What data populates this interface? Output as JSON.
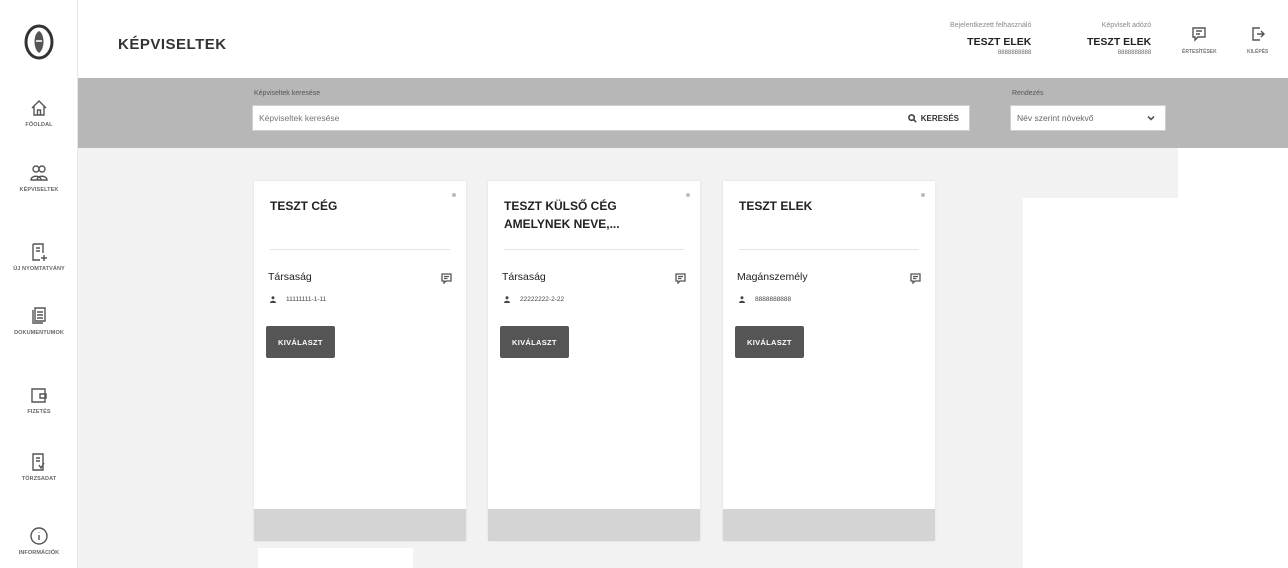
{
  "sidebar": {
    "items": [
      {
        "id": "fooldal",
        "label": "FŐOLDAL",
        "icon": "home-icon"
      },
      {
        "id": "kepviseltek",
        "label": "KÉPVISELTEK",
        "icon": "users-icon"
      },
      {
        "id": "uj-nyomtatvany",
        "label": "ÚJ NYOMTATVÁNY",
        "icon": "new-form-icon"
      },
      {
        "id": "dokumentumok",
        "label": "DOKUMENTUMOK",
        "icon": "documents-icon"
      },
      {
        "id": "fizetes",
        "label": "FIZETÉS",
        "icon": "wallet-icon"
      },
      {
        "id": "torzsadat",
        "label": "TÖRZSADAT",
        "icon": "master-data-icon"
      },
      {
        "id": "informaciok",
        "label": "INFORMÁCIÓK",
        "icon": "info-icon"
      }
    ]
  },
  "header": {
    "title": "KÉPVISELTEK",
    "declarant": {
      "caption": "Bejelentkezett felhasználó",
      "name": "TESZT ELEK",
      "id": "8888888888"
    },
    "taxpayer": {
      "caption": "Képviselt adózó",
      "name": "TESZT ELEK",
      "id": "8888888888"
    },
    "messages_label": "ÉRTESÍTÉSEK",
    "logout_label": "KILÉPÉS"
  },
  "search": {
    "caption": "Képviseltek keresése",
    "placeholder": "Képviseltek keresése",
    "button_label": "KERESÉS",
    "sort_caption": "Rendezés",
    "sort_value": "Név szerint növekvő"
  },
  "cards": [
    {
      "title": "TESZT CÉG",
      "type": "Társaság",
      "id": "11111111-1-11",
      "button": "KIVÁLASZT"
    },
    {
      "title": "TESZT KÜLSŐ CÉG AMELYNEK NEVE,...",
      "type": "Társaság",
      "id": "22222222-2-22",
      "button": "KIVÁLASZT"
    },
    {
      "title": "TESZT ELEK",
      "type": "Magánszemély",
      "id": "8888888888",
      "button": "KIVÁLASZT"
    }
  ],
  "colors": {
    "accent_button": "#555555",
    "search_band": "#b7b7b7",
    "background": "#f2f2f2"
  }
}
